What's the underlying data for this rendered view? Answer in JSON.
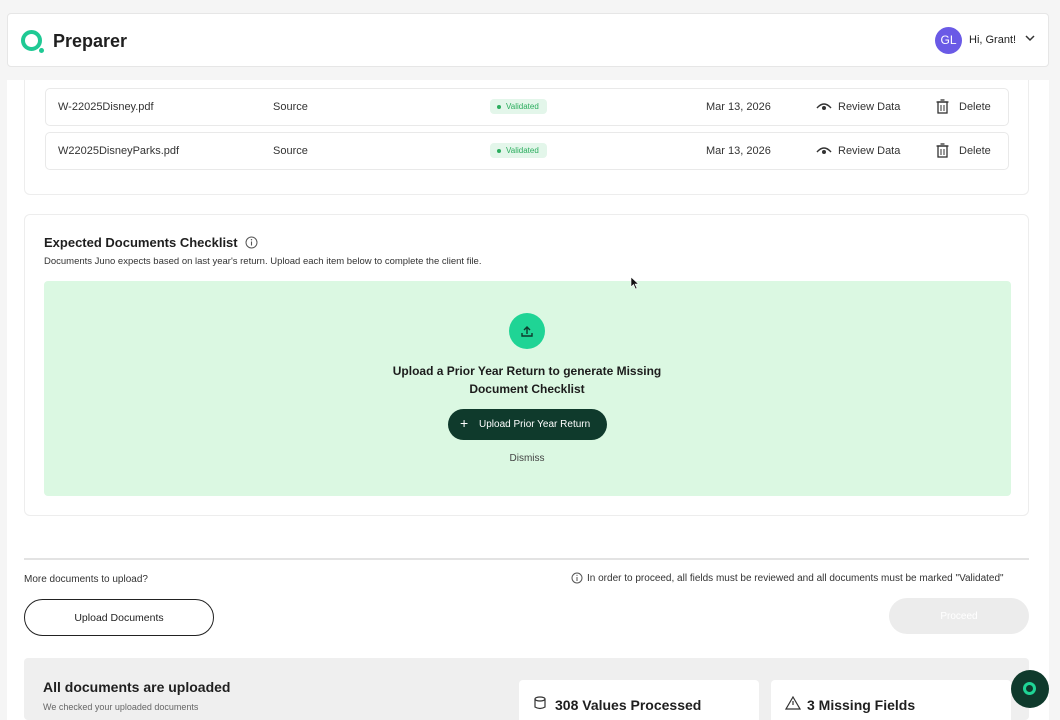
{
  "header": {
    "app_title": "Preparer",
    "avatar_initials": "GL",
    "greeting": "Hi, Grant!"
  },
  "documents": [
    {
      "name": "W-22025Disney.pdf",
      "type": "Source",
      "status": "Validated",
      "date": "Mar 13, 2026",
      "review_label": "Review Data",
      "delete_label": "Delete"
    },
    {
      "name": "W22025DisneyParks.pdf",
      "type": "Source",
      "status": "Validated",
      "date": "Mar 13, 2026",
      "review_label": "Review Data",
      "delete_label": "Delete"
    }
  ],
  "checklist": {
    "title": "Expected Documents Checklist",
    "subtitle": "Documents Juno expects based on last year's return. Upload each item below to complete the client file.",
    "upload_prompt": "Upload a Prior Year Return to generate Missing Document Checklist",
    "upload_button": "Upload Prior Year Return",
    "dismiss": "Dismiss"
  },
  "footer": {
    "more_docs": "More documents to upload?",
    "proceed_note": "In order to proceed, all fields must be reviewed and all documents must be marked \"Validated\"",
    "upload_docs_button": "Upload Documents",
    "next_button": "Proceed"
  },
  "summary": {
    "title": "All documents are uploaded",
    "subtitle": "We checked your uploaded documents",
    "values_processed": "308 Values Processed",
    "missing_fields": "3 Missing Fields"
  },
  "colors": {
    "brand_green": "#1fd495",
    "dark_green": "#0f3a2c",
    "upload_zone_bg": "#dbf8e2",
    "validated_badge": "#2bad5e",
    "avatar": "#6a5ae6"
  }
}
